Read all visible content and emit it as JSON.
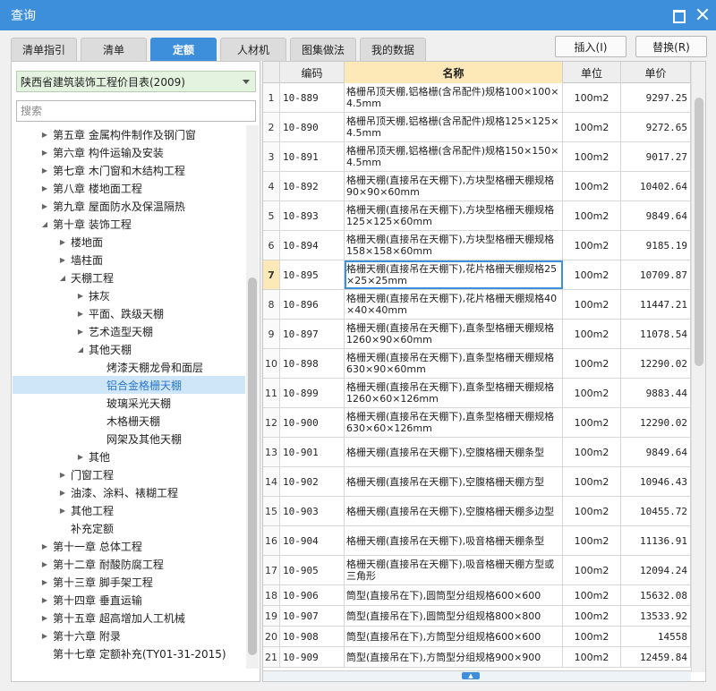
{
  "window": {
    "title": "查询"
  },
  "tabs": [
    {
      "label": "清单指引",
      "active": false
    },
    {
      "label": "清单",
      "active": false
    },
    {
      "label": "定额",
      "active": true
    },
    {
      "label": "人材机",
      "active": false
    },
    {
      "label": "图集做法",
      "active": false
    },
    {
      "label": "我的数据",
      "active": false
    }
  ],
  "actions": {
    "insert": "插入(I)",
    "replace": "替换(R)"
  },
  "left": {
    "library": "陕西省建筑装饰工程价目表(2009)",
    "search_placeholder": "搜索",
    "tree": [
      {
        "label": "第五章 金属构件制作及钢门窗",
        "level": 0,
        "twisty": "right"
      },
      {
        "label": "第六章 构件运输及安装",
        "level": 0,
        "twisty": "right"
      },
      {
        "label": "第七章 木门窗和木结构工程",
        "level": 0,
        "twisty": "right"
      },
      {
        "label": "第八章 楼地面工程",
        "level": 0,
        "twisty": "right"
      },
      {
        "label": "第九章 屋面防水及保温隔热",
        "level": 0,
        "twisty": "right"
      },
      {
        "label": "第十章 装饰工程",
        "level": 0,
        "twisty": "down"
      },
      {
        "label": "楼地面",
        "level": 1,
        "twisty": "right"
      },
      {
        "label": "墙柱面",
        "level": 1,
        "twisty": "right"
      },
      {
        "label": "天棚工程",
        "level": 1,
        "twisty": "down"
      },
      {
        "label": "抹灰",
        "level": 2,
        "twisty": "right"
      },
      {
        "label": "平面、跌级天棚",
        "level": 2,
        "twisty": "right"
      },
      {
        "label": "艺术造型天棚",
        "level": 2,
        "twisty": "right"
      },
      {
        "label": "其他天棚",
        "level": 2,
        "twisty": "down"
      },
      {
        "label": "烤漆天棚龙骨和面层",
        "level": 3,
        "twisty": "none"
      },
      {
        "label": "铝合金格栅天棚",
        "level": 3,
        "twisty": "none",
        "selected": true
      },
      {
        "label": "玻璃采光天棚",
        "level": 3,
        "twisty": "none"
      },
      {
        "label": "木格栅天棚",
        "level": 3,
        "twisty": "none"
      },
      {
        "label": "网架及其他天棚",
        "level": 3,
        "twisty": "none"
      },
      {
        "label": "其他",
        "level": 2,
        "twisty": "right"
      },
      {
        "label": "门窗工程",
        "level": 1,
        "twisty": "right"
      },
      {
        "label": "油漆、涂料、裱糊工程",
        "level": 1,
        "twisty": "right"
      },
      {
        "label": "其他工程",
        "level": 1,
        "twisty": "right"
      },
      {
        "label": "补充定额",
        "level": 1,
        "twisty": "none"
      },
      {
        "label": "第十一章 总体工程",
        "level": 0,
        "twisty": "right"
      },
      {
        "label": "第十二章 耐酸防腐工程",
        "level": 0,
        "twisty": "right"
      },
      {
        "label": "第十三章 脚手架工程",
        "level": 0,
        "twisty": "right"
      },
      {
        "label": "第十四章 垂直运输",
        "level": 0,
        "twisty": "right"
      },
      {
        "label": "第十五章 超高增加人工机械",
        "level": 0,
        "twisty": "right"
      },
      {
        "label": "第十六章 附录",
        "level": 0,
        "twisty": "right"
      },
      {
        "label": "第十七章 定额补充(TY01-31-2015)",
        "level": 0,
        "twisty": "none"
      }
    ]
  },
  "grid": {
    "headers": {
      "code": "编码",
      "name": "名称",
      "unit": "单位",
      "price": "单价"
    },
    "current_row": 7,
    "rows": [
      {
        "idx": "1",
        "code": "10-889",
        "name": "格栅吊顶天棚,铝格栅(含吊配件)规格100×100×4.5mm",
        "unit": "100m2",
        "price": "9297.25"
      },
      {
        "idx": "2",
        "code": "10-890",
        "name": "格栅吊顶天棚,铝格栅(含吊配件)规格125×125×4.5mm",
        "unit": "100m2",
        "price": "9272.65"
      },
      {
        "idx": "3",
        "code": "10-891",
        "name": "格栅吊顶天棚,铝格栅(含吊配件)规格150×150×4.5mm",
        "unit": "100m2",
        "price": "9017.27"
      },
      {
        "idx": "4",
        "code": "10-892",
        "name": "格栅天棚(直接吊在天棚下),方块型格栅天棚规格90×90×60mm",
        "unit": "100m2",
        "price": "10402.64"
      },
      {
        "idx": "5",
        "code": "10-893",
        "name": "格栅天棚(直接吊在天棚下),方块型格栅天棚规格125×125×60mm",
        "unit": "100m2",
        "price": "9849.64"
      },
      {
        "idx": "6",
        "code": "10-894",
        "name": "格栅天棚(直接吊在天棚下),方块型格栅天棚规格158×158×60mm",
        "unit": "100m2",
        "price": "9185.19"
      },
      {
        "idx": "7",
        "code": "10-895",
        "name": "格栅天棚(直接吊在天棚下),花片格栅天棚规格25×25×25mm",
        "unit": "100m2",
        "price": "10709.87"
      },
      {
        "idx": "8",
        "code": "10-896",
        "name": "格栅天棚(直接吊在天棚下),花片格栅天棚规格40×40×40mm",
        "unit": "100m2",
        "price": "11447.21"
      },
      {
        "idx": "9",
        "code": "10-897",
        "name": "格栅天棚(直接吊在天棚下),直条型格栅天棚规格1260×90×60mm",
        "unit": "100m2",
        "price": "11078.54"
      },
      {
        "idx": "10",
        "code": "10-898",
        "name": "格栅天棚(直接吊在天棚下),直条型格栅天棚规格630×90×60mm",
        "unit": "100m2",
        "price": "12290.02"
      },
      {
        "idx": "11",
        "code": "10-899",
        "name": "格栅天棚(直接吊在天棚下),直条型格栅天棚规格1260×60×126mm",
        "unit": "100m2",
        "price": "9883.44"
      },
      {
        "idx": "12",
        "code": "10-900",
        "name": "格栅天棚(直接吊在天棚下),直条型格栅天棚规格630×60×126mm",
        "unit": "100m2",
        "price": "12290.02"
      },
      {
        "idx": "13",
        "code": "10-901",
        "name": "格栅天棚(直接吊在天棚下),空腹格栅天棚条型",
        "unit": "100m2",
        "price": "9849.64"
      },
      {
        "idx": "14",
        "code": "10-902",
        "name": "格栅天棚(直接吊在天棚下),空腹格栅天棚方型",
        "unit": "100m2",
        "price": "10946.43"
      },
      {
        "idx": "15",
        "code": "10-903",
        "name": "格栅天棚(直接吊在天棚下),空腹格栅天棚多边型",
        "unit": "100m2",
        "price": "10455.72"
      },
      {
        "idx": "16",
        "code": "10-904",
        "name": "格栅天棚(直接吊在天棚下),吸音格栅天棚条型",
        "unit": "100m2",
        "price": "11136.91"
      },
      {
        "idx": "17",
        "code": "10-905",
        "name": "格栅天棚(直接吊在天棚下),吸音格栅天棚方型或三角形",
        "unit": "100m2",
        "price": "12094.24"
      },
      {
        "idx": "18",
        "code": "10-906",
        "name": "筒型(直接吊在下),圆筒型分组规格600×600",
        "unit": "100m2",
        "price": "15632.08"
      },
      {
        "idx": "19",
        "code": "10-907",
        "name": "筒型(直接吊在下),圆筒型分组规格800×800",
        "unit": "100m2",
        "price": "13533.92"
      },
      {
        "idx": "20",
        "code": "10-908",
        "name": "筒型(直接吊在下),方筒型分组规格600×600",
        "unit": "100m2",
        "price": "14558"
      },
      {
        "idx": "21",
        "code": "10-909",
        "name": "筒型(直接吊在下),方筒型分组规格900×900",
        "unit": "100m2",
        "price": "12459.84"
      }
    ]
  }
}
